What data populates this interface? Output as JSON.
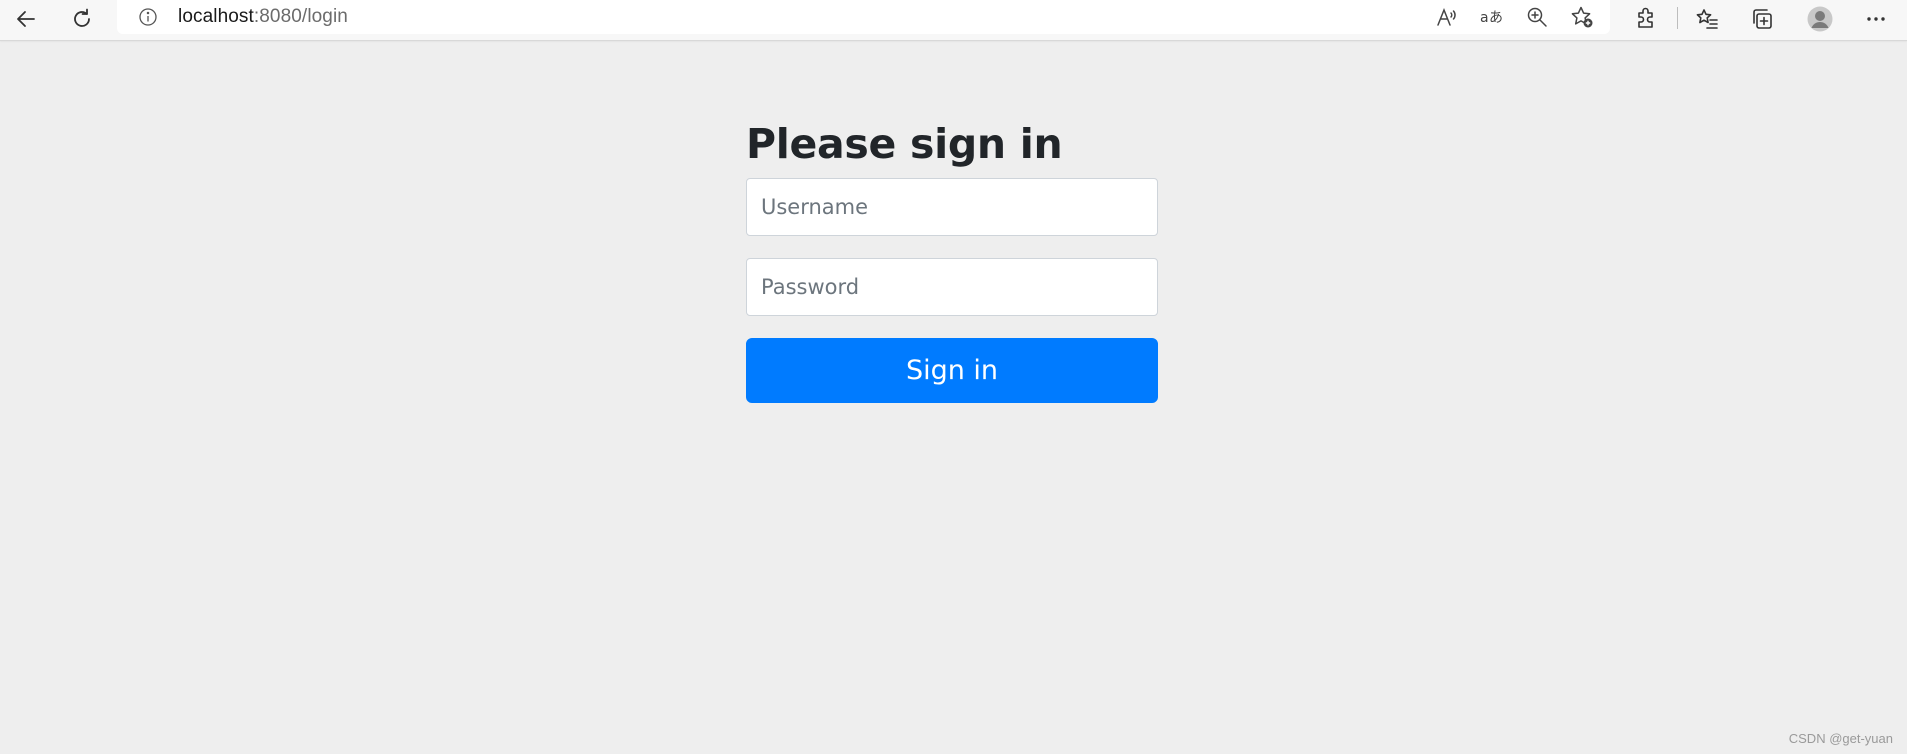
{
  "browser": {
    "url_host": "localhost",
    "url_path": ":8080/login",
    "icons": {
      "back": "back-arrow-icon",
      "refresh": "refresh-icon",
      "site_info": "info-icon",
      "read_aloud": "read-aloud-icon",
      "translate": "translate-icon",
      "zoom": "zoom-icon",
      "favorite": "add-favorite-icon",
      "extensions": "extensions-icon",
      "favorites": "favorites-icon",
      "collections": "collections-icon",
      "profile": "profile-icon",
      "menu": "more-icon"
    }
  },
  "login": {
    "title": "Please sign in",
    "username_placeholder": "Username",
    "password_placeholder": "Password",
    "submit_label": "Sign in"
  },
  "colors": {
    "page_background": "#eeeeee",
    "primary_button": "#007bff",
    "heading_text": "#212529"
  },
  "watermark": "CSDN @get-yuan"
}
